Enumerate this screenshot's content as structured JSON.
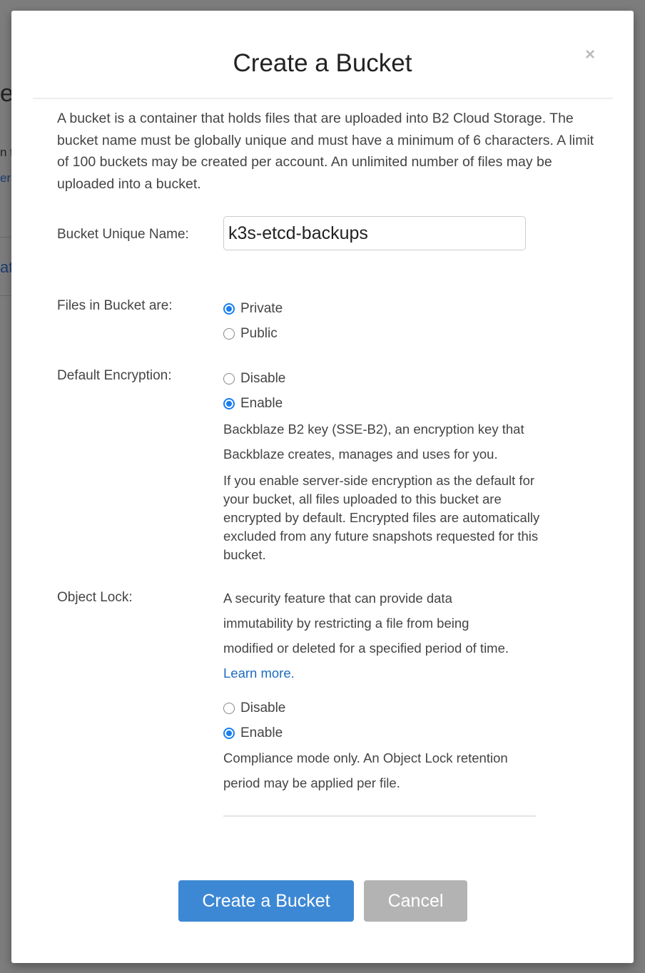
{
  "background_fragments": [
    "e",
    "n t",
    "er",
    "at"
  ],
  "modal": {
    "title": "Create a Bucket",
    "close_icon": "close-x-icon",
    "description": "A bucket is a container that holds files that are uploaded into B2 Cloud Storage. The bucket name must be globally unique and must have a minimum of 6 characters. A limit of 100 buckets may be created per account. An unlimited number of files may be uploaded into a bucket.",
    "bucket_name": {
      "label": "Bucket Unique Name:",
      "value": "k3s-etcd-backups"
    },
    "files_visibility": {
      "label": "Files in Bucket are:",
      "options": [
        {
          "label": "Private",
          "selected": true
        },
        {
          "label": "Public",
          "selected": false
        }
      ]
    },
    "encryption": {
      "label": "Default Encryption:",
      "options": [
        {
          "label": "Disable",
          "selected": false
        },
        {
          "label": "Enable",
          "selected": true
        }
      ],
      "key_note": "Backblaze B2 key (SSE-B2), an encryption key that Backblaze creates, manages and uses for you.",
      "info": "If you enable server-side encryption as the default for your bucket, all files uploaded to this bucket are encrypted by default. Encrypted files are automatically excluded from any future snapshots requested for this bucket."
    },
    "object_lock": {
      "label": "Object Lock:",
      "description": "A security feature that can provide data immutability by restricting a file from being modified or deleted for a specified period of time.",
      "learn_more": "Learn more.",
      "options": [
        {
          "label": "Disable",
          "selected": false
        },
        {
          "label": "Enable",
          "selected": true
        }
      ],
      "note": "Compliance mode only. An Object Lock retention period may be applied per file."
    },
    "buttons": {
      "create": "Create a Bucket",
      "cancel": "Cancel"
    },
    "colors": {
      "primary": "#3d88d4",
      "cancel": "#b3b3b3",
      "radio": "#1a7ef0",
      "link": "#1d6bc0"
    }
  }
}
